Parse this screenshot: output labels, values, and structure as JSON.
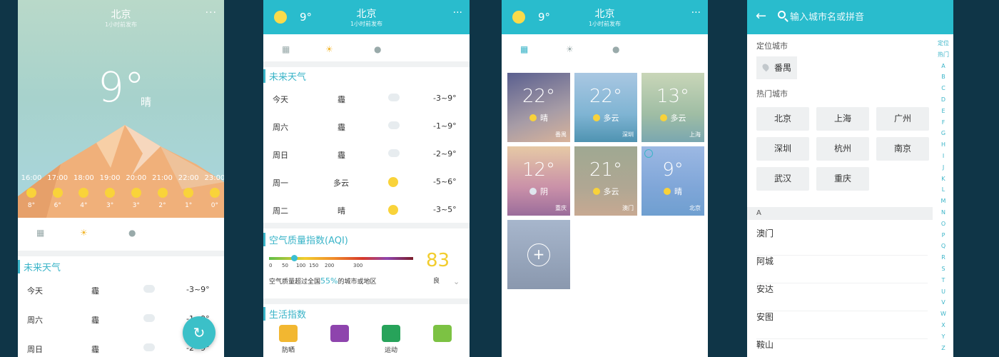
{
  "colors": {
    "accent": "#29bccd",
    "sun": "#f9d33a",
    "aqi": "#f2cd2e",
    "background": "#0f3547"
  },
  "s1": {
    "city": "北京",
    "updated": "1小时前发布",
    "more": "···",
    "temp": "9°",
    "condition": "晴",
    "hours": [
      {
        "time": "16:00",
        "temp": "8°"
      },
      {
        "time": "17:00",
        "temp": "6°"
      },
      {
        "time": "18:00",
        "temp": "4°"
      },
      {
        "time": "19:00",
        "temp": "3°"
      },
      {
        "time": "20:00",
        "temp": "3°"
      },
      {
        "time": "21:00",
        "temp": "2°"
      },
      {
        "time": "22:00",
        "temp": "1°"
      },
      {
        "time": "23:00",
        "temp": "0°"
      }
    ],
    "tabs": [
      "building-icon",
      "sun-icon",
      "person-icon"
    ],
    "section": "未来天气",
    "forecast": [
      {
        "day": "今天",
        "cond": "霾",
        "range": "-3~9°"
      },
      {
        "day": "周六",
        "cond": "霾",
        "range": "-1~9°"
      },
      {
        "day": "周日",
        "cond": "霾",
        "range": "-2~9°"
      }
    ],
    "refresh": "↻"
  },
  "s2": {
    "temp": "9°",
    "city": "北京",
    "updated": "1小时前发布",
    "more": "···",
    "section_forecast": "未来天气",
    "forecast": [
      {
        "day": "今天",
        "cond": "霾",
        "range": "-3~9°",
        "icon": "cloud"
      },
      {
        "day": "周六",
        "cond": "霾",
        "range": "-1~9°",
        "icon": "cloud"
      },
      {
        "day": "周日",
        "cond": "霾",
        "range": "-2~9°",
        "icon": "cloud"
      },
      {
        "day": "周一",
        "cond": "多云",
        "range": "-5~6°",
        "icon": "sun"
      },
      {
        "day": "周二",
        "cond": "晴",
        "range": "-3~5°",
        "icon": "sun"
      }
    ],
    "section_aqi": "空气质量指数(AQI)",
    "aqi_ticks": [
      "0",
      "50",
      "100",
      "150",
      "200",
      "300"
    ],
    "aqi_value": "83",
    "aqi_level": "良",
    "aqi_desc_pre": "空气质量超过全国",
    "aqi_desc_pct": "55%",
    "aqi_desc_post": "的城市或地区",
    "section_life": "生活指数",
    "life": [
      {
        "label": "防晒",
        "color": "#f2b731"
      },
      {
        "label": "",
        "color": "#8e44ad"
      },
      {
        "label": "运动",
        "color": "#27a35a"
      },
      {
        "label": "",
        "color": "#7cc243"
      }
    ]
  },
  "s3": {
    "temp": "9°",
    "city": "北京",
    "updated": "1小时前发布",
    "more": "···",
    "cards": [
      {
        "temp": "22°",
        "cond": "晴",
        "city": "番禺",
        "bg": "linear-gradient(160deg,#5a5f8f,#a79ca6 60%,#d9b39a)",
        "icon": "#f8d23a"
      },
      {
        "temp": "22°",
        "cond": "多云",
        "city": "深圳",
        "bg": "linear-gradient(180deg,#a9c7e2,#7fb4d3 60%,#4f93b1)",
        "icon": "#f8d23a"
      },
      {
        "temp": "13°",
        "cond": "多云",
        "city": "上海",
        "bg": "linear-gradient(180deg,#c9d6b8,#9fbda4 60%,#7aa7b0)",
        "icon": "#f8d23a"
      },
      {
        "temp": "12°",
        "cond": "阴",
        "city": "重庆",
        "bg": "linear-gradient(180deg,#e6c9a5,#c990a8 60%,#9b6d9b)",
        "icon": "#dfe6ee"
      },
      {
        "temp": "21°",
        "cond": "多云",
        "city": "澳门",
        "bg": "linear-gradient(180deg,#9fa892,#b0a793 60%,#c7a992)",
        "icon": "#f8d23a"
      },
      {
        "temp": "9°",
        "cond": "晴",
        "city": "北京",
        "bg": "linear-gradient(180deg,#9cb8e3,#7fa6d8 60%,#6f9fd0)",
        "icon": "#f8d23a"
      }
    ],
    "add": "+"
  },
  "s4": {
    "back": "←",
    "search_placeholder": "输入城市名或拼音",
    "located_label": "定位城市",
    "located_city": "番禺",
    "hot_label": "热门城市",
    "hot": [
      "北京",
      "上海",
      "广州",
      "深圳",
      "杭州",
      "南京",
      "武汉",
      "重庆"
    ],
    "alpha_head": "A",
    "cities": [
      "澳门",
      "阿城",
      "安达",
      "安图",
      "鞍山"
    ],
    "index": [
      "定位",
      "热门",
      "A",
      "B",
      "C",
      "D",
      "E",
      "F",
      "G",
      "H",
      "I",
      "J",
      "K",
      "L",
      "M",
      "N",
      "O",
      "P",
      "Q",
      "R",
      "S",
      "T",
      "U",
      "V",
      "W",
      "X",
      "Y",
      "Z"
    ]
  }
}
